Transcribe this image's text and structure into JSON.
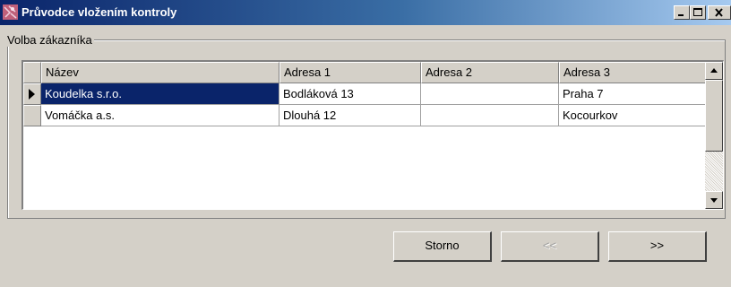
{
  "window": {
    "title": "Průvodce vložením kontroly"
  },
  "titlebar_buttons": {
    "minimize_icon": "minimize-icon",
    "maximize_icon": "maximize-icon",
    "close_icon": "close-icon"
  },
  "group": {
    "label": "Volba zákazníka"
  },
  "grid": {
    "columns": [
      "Název",
      "Adresa 1",
      "Adresa 2",
      "Adresa 3"
    ],
    "rows": [
      {
        "name": "Koudelka s.r.o.",
        "addr1": "Bodláková 13",
        "addr2": "",
        "addr3": "Praha 7",
        "selected": true
      },
      {
        "name": "Vomáčka a.s.",
        "addr1": "Dlouhá 12",
        "addr2": "",
        "addr3": "Kocourkov",
        "selected": false
      }
    ]
  },
  "buttons": {
    "cancel": "Storno",
    "back": "<<",
    "next": ">>"
  },
  "colors": {
    "title_gradient_start": "#0a246a",
    "title_gradient_end": "#a6caf0",
    "selection": "#0a246a",
    "face": "#d4d0c8"
  }
}
